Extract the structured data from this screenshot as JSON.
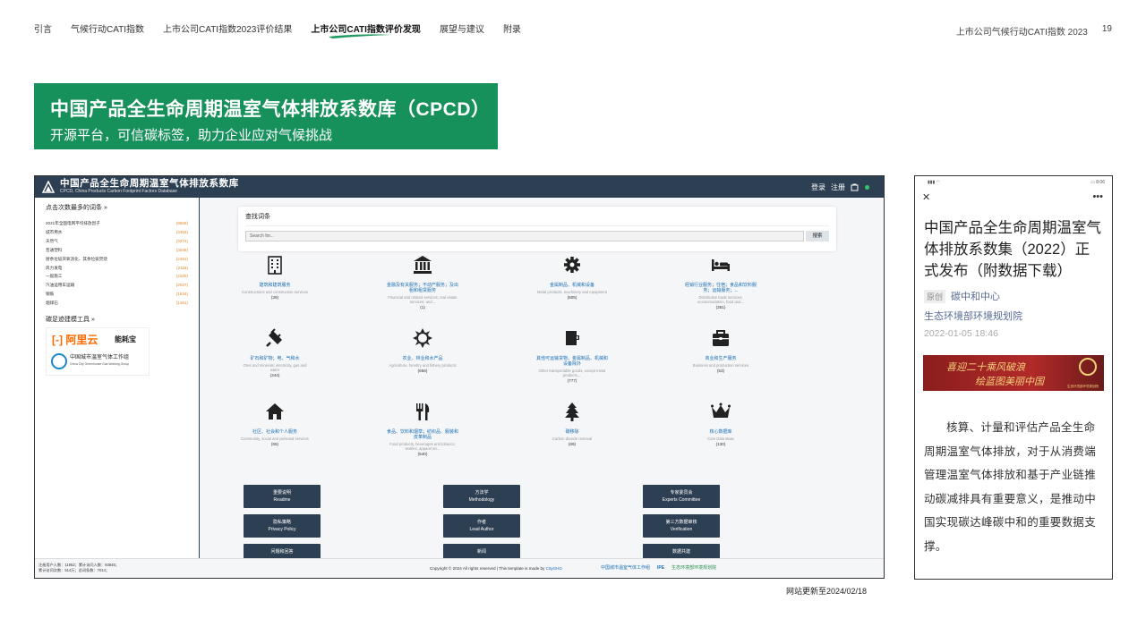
{
  "nav": {
    "items": [
      "引言",
      "气候行动CATI指数",
      "上市公司CATI指数2023评价结果",
      "上市公司CATI指数评价发现",
      "展望与建议",
      "附录"
    ],
    "active_index": 3
  },
  "header_right": {
    "report": "上市公司气候行动CATI指数 2023",
    "page": "19"
  },
  "banner": {
    "title": "中国产品全生命周期温室气体排放系数库（CPCD）",
    "subtitle": "开源平台，可信碳标签，助力企业应对气候挑战"
  },
  "site": {
    "title": "中国产品全生命周期温室气体排放系数库",
    "subtitle": "CPCD, China Products Carbon Footprint Factors Database",
    "login": "登录",
    "register": "注册",
    "sidebar": {
      "heading": "点击次数最多的词条 »",
      "items": [
        {
          "label": "2021年全国电网平均排放因子",
          "count": "(8565)"
        },
        {
          "label": "城市用水",
          "count": "(3463)"
        },
        {
          "label": "天然气",
          "count": "(3274)"
        },
        {
          "label": "普通塑料",
          "count": "(3046)"
        },
        {
          "label": "厨余垃圾厌氧消化、其余垃圾焚烧",
          "count": "(2461)"
        },
        {
          "label": "风力发电",
          "count": "(2118)"
        },
        {
          "label": "一般施工",
          "count": "(2100)"
        },
        {
          "label": "汽油运用车运输",
          "count": "(2027)"
        },
        {
          "label": "钢筋",
          "count": "(1634)"
        },
        {
          "label": "烟煤石",
          "count": "(1461)"
        }
      ],
      "tools_heading": "碳足迹建模工具 »",
      "tool_aliyun": "阿里云",
      "tool_nenghao": "能耗宝",
      "tool_cgw": "中国城市温室气体工作组",
      "tool_cgw_en": "China City Greenhouse Gas Working Group"
    },
    "search": {
      "title": "查找词条",
      "placeholder": "Search for...",
      "button": "搜索"
    },
    "tiles": [
      {
        "icon": "building-icon",
        "cn": "建筑和建筑服务",
        "en": "Constructions and construction services",
        "num": "(39)"
      },
      {
        "icon": "bank-icon",
        "cn": "金融及有关服务；不动产服务；及出租和租赁服务",
        "en": "Financial and related services; real estate services; and...",
        "num": "(1)"
      },
      {
        "icon": "gear-icon",
        "cn": "金属制品、机械和设备",
        "en": "Metal products, machinery and equipment",
        "num": "(605)"
      },
      {
        "icon": "bed-icon",
        "cn": "经销行业服务；住宿；食品和饮料服务；运输服务；...",
        "en": "Distributive trade services; accommodation, food and...",
        "num": "(351)"
      },
      {
        "icon": "plug-icon",
        "cn": "矿石和矿物；电、气和水",
        "en": "Ores and minerals; electricity, gas and water",
        "num": "(344)"
      },
      {
        "icon": "sun-icon",
        "cn": "农业、林业和水产品",
        "en": "Agriculture, forestry and fishery products",
        "num": "(656)"
      },
      {
        "icon": "cup-icon",
        "cn": "其他可运输货物，金属制品、机械和设备除外",
        "en": "Other transportable goods, except metal products,...",
        "num": "(777)"
      },
      {
        "icon": "briefcase-icon",
        "cn": "商业和生产服务",
        "en": "Business and production services",
        "num": "(53)"
      },
      {
        "icon": "home-icon",
        "cn": "社区、社会和个人服务",
        "en": "Community, social and personal services",
        "num": "(65)"
      },
      {
        "icon": "utensils-icon",
        "cn": "食品、饮料和烟草；纺织品、服装和皮革制品",
        "en": "Food products, beverages and tobacco; textiles, apparel an...",
        "num": "(540)"
      },
      {
        "icon": "tree-icon",
        "cn": "碳移除",
        "en": "Carbon dioxide removal",
        "num": "(69)"
      },
      {
        "icon": "crown-icon",
        "cn": "核心数据库",
        "en": "Core Data Base",
        "num": "(130)"
      }
    ],
    "buttons": [
      {
        "cn": "重要说明",
        "en": "Readme"
      },
      {
        "cn": "方法学",
        "en": "Methodology"
      },
      {
        "cn": "专家委员会",
        "en": "Experts Committee"
      },
      {
        "cn": "隐私策略",
        "en": "Privacy Policy"
      },
      {
        "cn": "作者",
        "en": "Lead Author"
      },
      {
        "cn": "第三方数据审核",
        "en": "Verification"
      },
      {
        "cn": "问题和回答",
        "en": ""
      },
      {
        "cn": "新闻",
        "en": ""
      },
      {
        "cn": "数据共建",
        "en": ""
      }
    ],
    "footer": {
      "stats_line1": "注册用户人数：11952；累计访问人数：93845；",
      "stats_line2": "累计访问次数：514万；总词条数：7014；",
      "copyright": "Copyright © 2024 All rights reserved | This template is made by ",
      "copyright_link": "CityGHG",
      "logo1": "中国城市温室气体工作组",
      "logo2": "IPE",
      "logo3": "生态环境部环境规划院"
    }
  },
  "updated_note": "网站更新至2024/02/18",
  "phone": {
    "time": "8:06",
    "title": "中国产品全生命周期温室气体排放系数集（2022）正式发布（附数据下载）",
    "original_tag": "原创",
    "account": "碳中和中心",
    "org": "生态环境部环境规划院",
    "date": "2022-01-05 18:46",
    "banner_line1": "喜迎二十乘风破浪",
    "banner_line2": "绘蓝图美丽中国",
    "banner_small": "生态环境部环境规划院",
    "body": "核算、计量和评估产品全生命周期温室气体排放，对于从消费端管理温室气体排放和基于产业链推动碳减排具有重要意义，是推动中国实现碳达峰碳中和的重要数据支撑。"
  }
}
